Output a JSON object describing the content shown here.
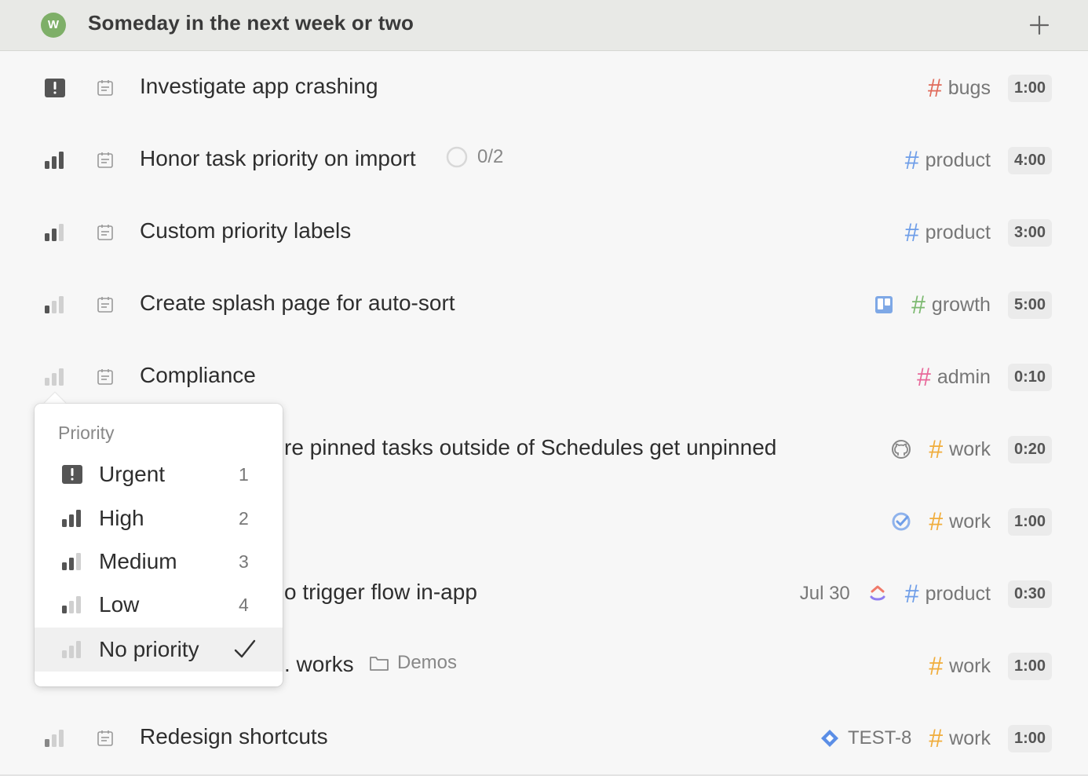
{
  "header": {
    "avatar_letter": "W",
    "title": "Someday in the next week or two",
    "add_icon": "plus-icon"
  },
  "colors": {
    "tag_bugs": "#e06b5b",
    "tag_product": "#6f9ee8",
    "tag_growth": "#7cb970",
    "tag_admin": "#e8689a",
    "tag_work": "#f0ad3c",
    "avatar": "#7eaf68"
  },
  "tasks": [
    {
      "priority": "urgent",
      "title": "Investigate app crashing",
      "tag": "bugs",
      "duration": "1:00"
    },
    {
      "priority": "high",
      "title": "Honor task priority on import",
      "progress": "0/2",
      "tag": "product",
      "duration": "4:00"
    },
    {
      "priority": "medium",
      "title": "Custom priority labels",
      "tag": "product",
      "duration": "3:00"
    },
    {
      "priority": "low",
      "title": "Create splash page for auto-sort",
      "integration": "trello-icon",
      "tag": "growth",
      "duration": "5:00"
    },
    {
      "priority": "none",
      "title": "Compliance",
      "tag": "admin",
      "duration": "0:10"
    },
    {
      "priority": "none",
      "title": "re pinned tasks outside of Schedules get unpinned",
      "integration": "github-icon",
      "tag": "work",
      "duration": "0:20"
    },
    {
      "priority": "none",
      "title": "",
      "integration": "check-target-icon",
      "tag": "work",
      "duration": "1:00"
    },
    {
      "priority": "none",
      "title": "o trigger flow in-app",
      "date": "Jul 30",
      "integration": "clickup-icon",
      "tag": "product",
      "duration": "0:30"
    },
    {
      "priority": "none",
      "title": ". works",
      "folder": "Demos",
      "tag": "work",
      "duration": "1:00"
    },
    {
      "priority": "low",
      "title": "Redesign shortcuts",
      "integration": "jira-icon",
      "integration_text": "TEST-8",
      "tag": "work",
      "duration": "1:00"
    }
  ],
  "priority_menu": {
    "heading": "Priority",
    "options": [
      {
        "label": "Urgent",
        "key": "1",
        "icon": "urgent-icon"
      },
      {
        "label": "High",
        "key": "2",
        "icon": "priority-high-icon"
      },
      {
        "label": "Medium",
        "key": "3",
        "icon": "priority-medium-icon"
      },
      {
        "label": "Low",
        "key": "4",
        "icon": "priority-low-icon"
      },
      {
        "label": "No priority",
        "key": "",
        "icon": "priority-none-icon",
        "selected": true
      }
    ]
  }
}
